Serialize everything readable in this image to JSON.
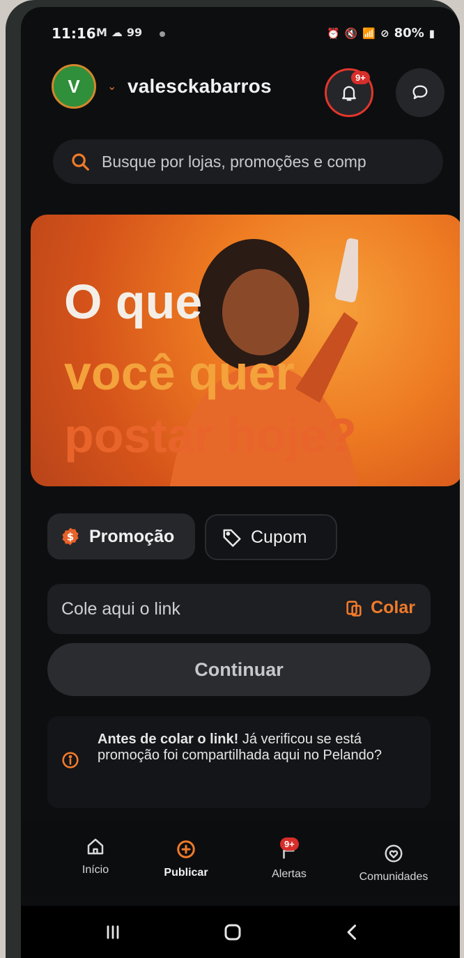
{
  "status_bar": {
    "time": "11:16",
    "left_icons": [
      "M",
      "☁",
      "99"
    ],
    "battery": "80%"
  },
  "header": {
    "avatar_initial": "V",
    "username": "valesckabarros",
    "notifications_badge": "9+"
  },
  "search": {
    "placeholder": "Busque por lojas, promoções e comp"
  },
  "hero": {
    "line1": "O que",
    "line2": "você quer",
    "line3": "postar hoje?"
  },
  "post_types": {
    "promo_label": "Promoção",
    "coupon_label": "Cupom"
  },
  "link_input": {
    "placeholder": "Cole aqui o link",
    "paste_label": "Colar"
  },
  "continue_label": "Continuar",
  "info": {
    "bold": "Antes de colar o link!",
    "text": "Já verificou se está promoção foi compartilhada aqui no Pelando?"
  },
  "bottom_nav": {
    "home": "Início",
    "publish": "Publicar",
    "alerts": "Alertas",
    "alerts_badge": "9+",
    "communities": "Comunidades"
  },
  "colors": {
    "accent": "#f07a2a",
    "badge": "#d62e2a",
    "background": "#0d0e10"
  }
}
